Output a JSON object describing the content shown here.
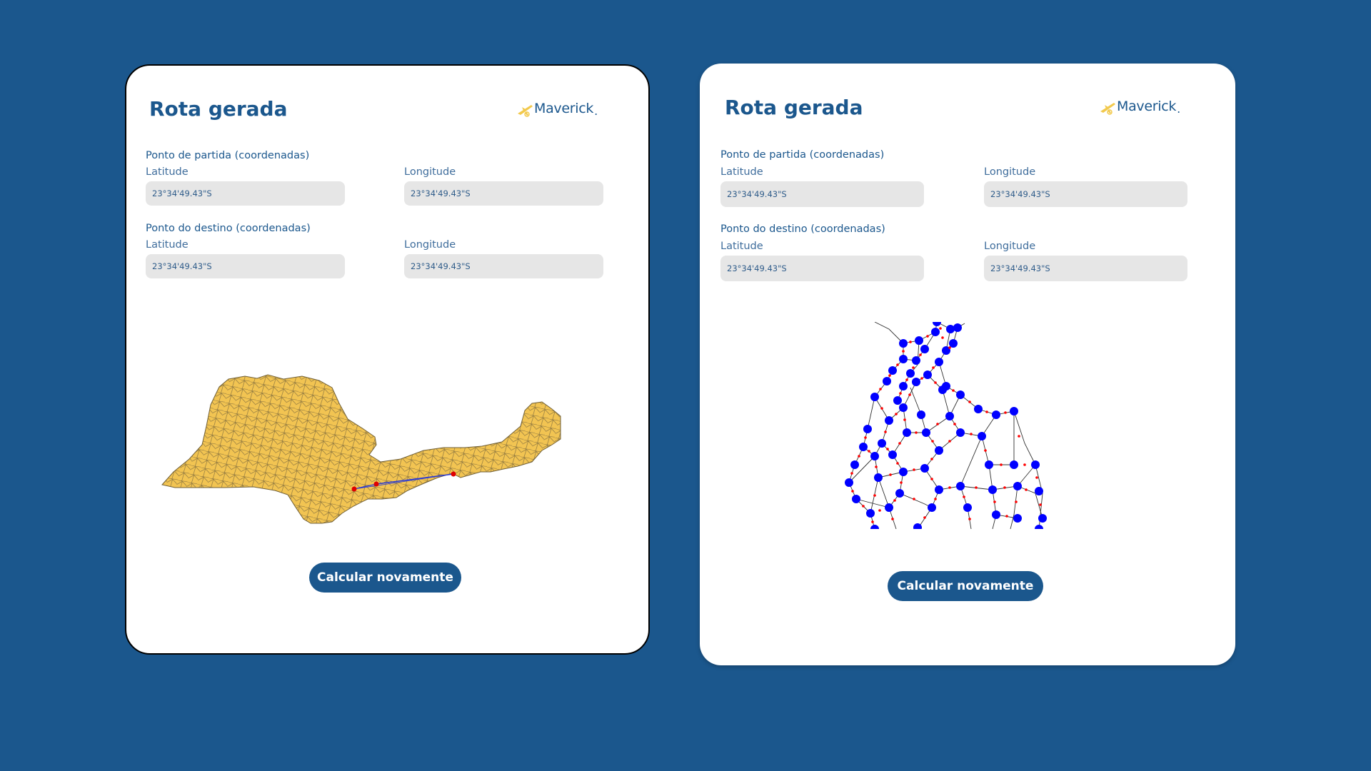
{
  "cards": [
    {
      "title": "Rota gerada",
      "logo_text": "Maverick",
      "start_section": "Ponto de partida (coordenadas)",
      "dest_section": "Ponto do destino (coordenadas)",
      "latitude_label": "Latitude",
      "longitude_label": "Longitude",
      "start_latitude": "23°34'49.43\"S",
      "start_longitude": "23°34'49.43\"S",
      "dest_latitude": "23°34'49.43\"S",
      "dest_longitude": "23°34'49.43\"S",
      "button_label": "Calcular novamente"
    },
    {
      "title": "Rota gerada",
      "logo_text": "Maverick",
      "start_section": "Ponto de partida (coordenadas)",
      "dest_section": "Ponto do destino (coordenadas)",
      "latitude_label": "Latitude",
      "longitude_label": "Longitude",
      "start_latitude": "23°34'49.43\"S",
      "start_longitude": "23°34'49.43\"S",
      "dest_latitude": "23°34'49.43\"S",
      "dest_longitude": "23°34'49.43\"S",
      "button_label": "Calcular novamente"
    }
  ],
  "colors": {
    "background": "#1b578d",
    "primary": "#1b578d",
    "field_bg": "#e6e6e6",
    "map_fill": "#f2c452",
    "logo_accent": "#f2c94c",
    "graph_node": "#0000ff",
    "graph_edge": "#ff0000"
  },
  "icons": {
    "logo": "airplane-icon"
  }
}
